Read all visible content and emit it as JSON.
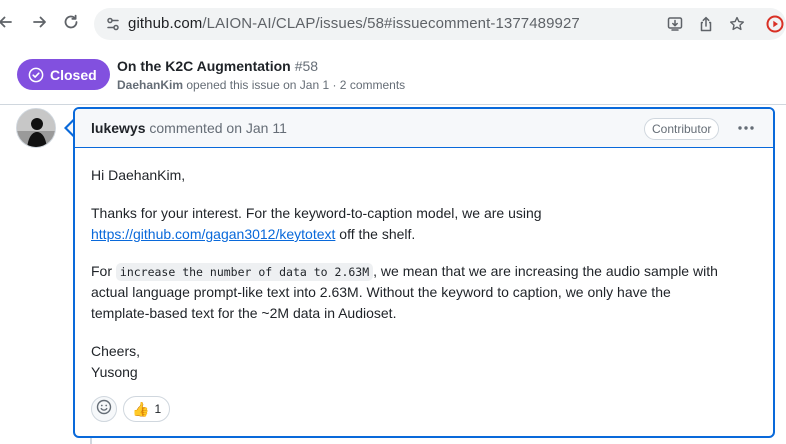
{
  "browser": {
    "url_host": "github.com",
    "url_path": "/LAION-AI/CLAP/issues/58#issuecomment-1377489927"
  },
  "issue": {
    "state": "Closed",
    "title": "On the K2C Augmentation",
    "number": "#58",
    "author": "DaehanKim",
    "meta_text": "opened this issue on Jan 1 · 2 comments"
  },
  "comment": {
    "author": "lukewys",
    "action": "commented on Jan 11",
    "role": "Contributor",
    "greeting": "Hi DaehanKim,",
    "para2_line1": "Thanks for your interest. For the keyword-to-caption model, we are using",
    "para2_link": "https://github.com/gagan3012/keytotext",
    "para2_after_link": " off the shelf.",
    "para3_prefix": "For ",
    "para3_code": "increase the number of data to 2.63M",
    "para3_line1_rest": ", we mean that we are increasing the audio sample with",
    "para3_line2": "actual language prompt-like text into 2.63M. Without the keyword to caption, we only have the",
    "para3_line3": "template-based text for the ~2M data in Audioset.",
    "signoff": "Cheers,",
    "signature": "Yusong",
    "reactions": [
      {
        "emoji": "👍",
        "count": "1",
        "icon": "thumbs-up-icon"
      }
    ]
  },
  "colors": {
    "closed_badge": "#8250df",
    "accent": "#0969da"
  }
}
